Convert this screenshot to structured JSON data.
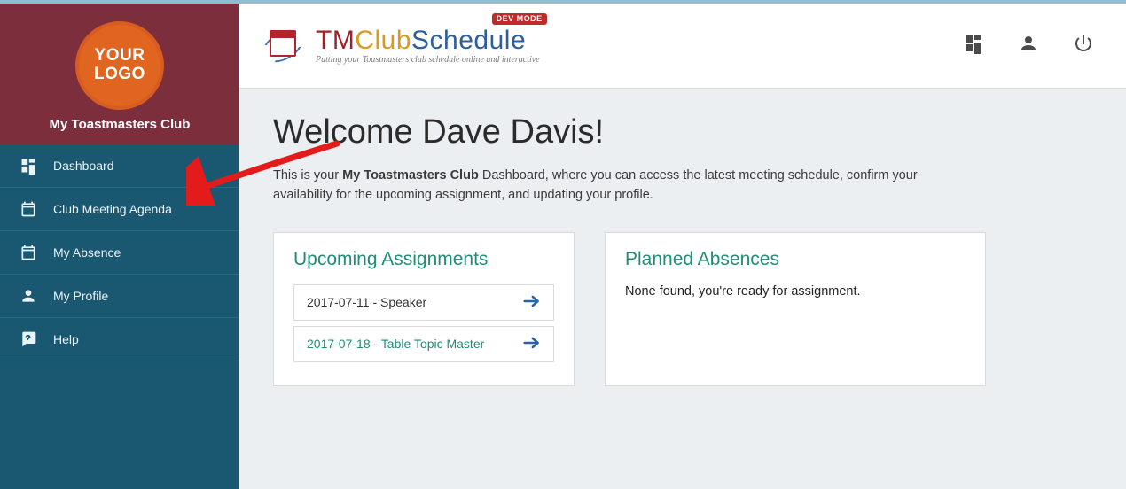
{
  "sidebar": {
    "logo_text": "YOUR LOGO",
    "club_name": "My Toastmasters Club",
    "items": [
      {
        "icon": "dashboard",
        "label": "Dashboard"
      },
      {
        "icon": "calendar",
        "label": "Club Meeting Agenda"
      },
      {
        "icon": "calendar",
        "label": "My Absence"
      },
      {
        "icon": "person",
        "label": "My Profile"
      },
      {
        "icon": "help",
        "label": "Help"
      }
    ]
  },
  "brand": {
    "tm": "TM",
    "club": "Club",
    "schedule": "Schedule",
    "tagline": "Putting your Toastmasters club schedule online and interactive",
    "dev_badge": "DEV MODE"
  },
  "topbar": {
    "actions": [
      "dashboard-icon",
      "account-icon",
      "power-icon"
    ]
  },
  "page": {
    "welcome": "Welcome Dave Davis!",
    "intro_before": "This is your ",
    "intro_bold": "My Toastmasters Club",
    "intro_after": " Dashboard, where you can access the latest meeting schedule, confirm your availability for the upcoming assignment, and updating your profile."
  },
  "upcoming": {
    "title": "Upcoming Assignments",
    "rows": [
      {
        "text": "2017-07-11 - Speaker"
      },
      {
        "text": "2017-07-18 - Table Topic Master"
      }
    ]
  },
  "absences": {
    "title": "Planned Absences",
    "none_text": "None found, you're ready for assignment."
  }
}
